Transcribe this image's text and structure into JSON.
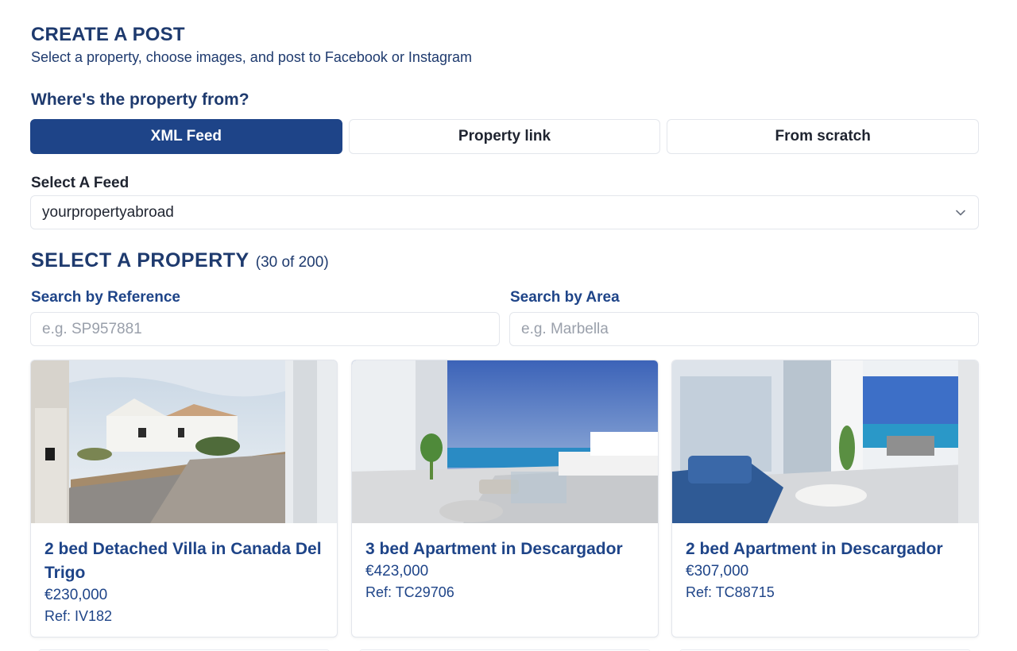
{
  "header": {
    "title": "CREATE A POST",
    "subtitle": "Select a property, choose images, and post to Facebook or Instagram"
  },
  "source": {
    "question": "Where's the property from?",
    "tabs": [
      {
        "label": "XML Feed",
        "active": true
      },
      {
        "label": "Property link",
        "active": false
      },
      {
        "label": "From scratch",
        "active": false
      }
    ]
  },
  "feed": {
    "label": "Select A Feed",
    "selected": "yourpropertyabroad"
  },
  "property": {
    "title": "SELECT A PROPERTY",
    "count": "(30 of 200)"
  },
  "search": {
    "reference_label": "Search by Reference",
    "reference_placeholder": "e.g. SP957881",
    "area_label": "Search by Area",
    "area_placeholder": "e.g. Marbella"
  },
  "cards": [
    {
      "title": "2 bed Detached Villa in Canada Del Trigo",
      "price": "€230,000",
      "ref": "Ref: IV182"
    },
    {
      "title": "3 bed Apartment in Descargador",
      "price": "€423,000",
      "ref": "Ref: TC29706"
    },
    {
      "title": "2 bed Apartment in Descargador",
      "price": "€307,000",
      "ref": "Ref: TC88715"
    }
  ],
  "colors": {
    "primary": "#1e4488",
    "heading": "#1e3a6e",
    "border": "#e3e6ec"
  }
}
